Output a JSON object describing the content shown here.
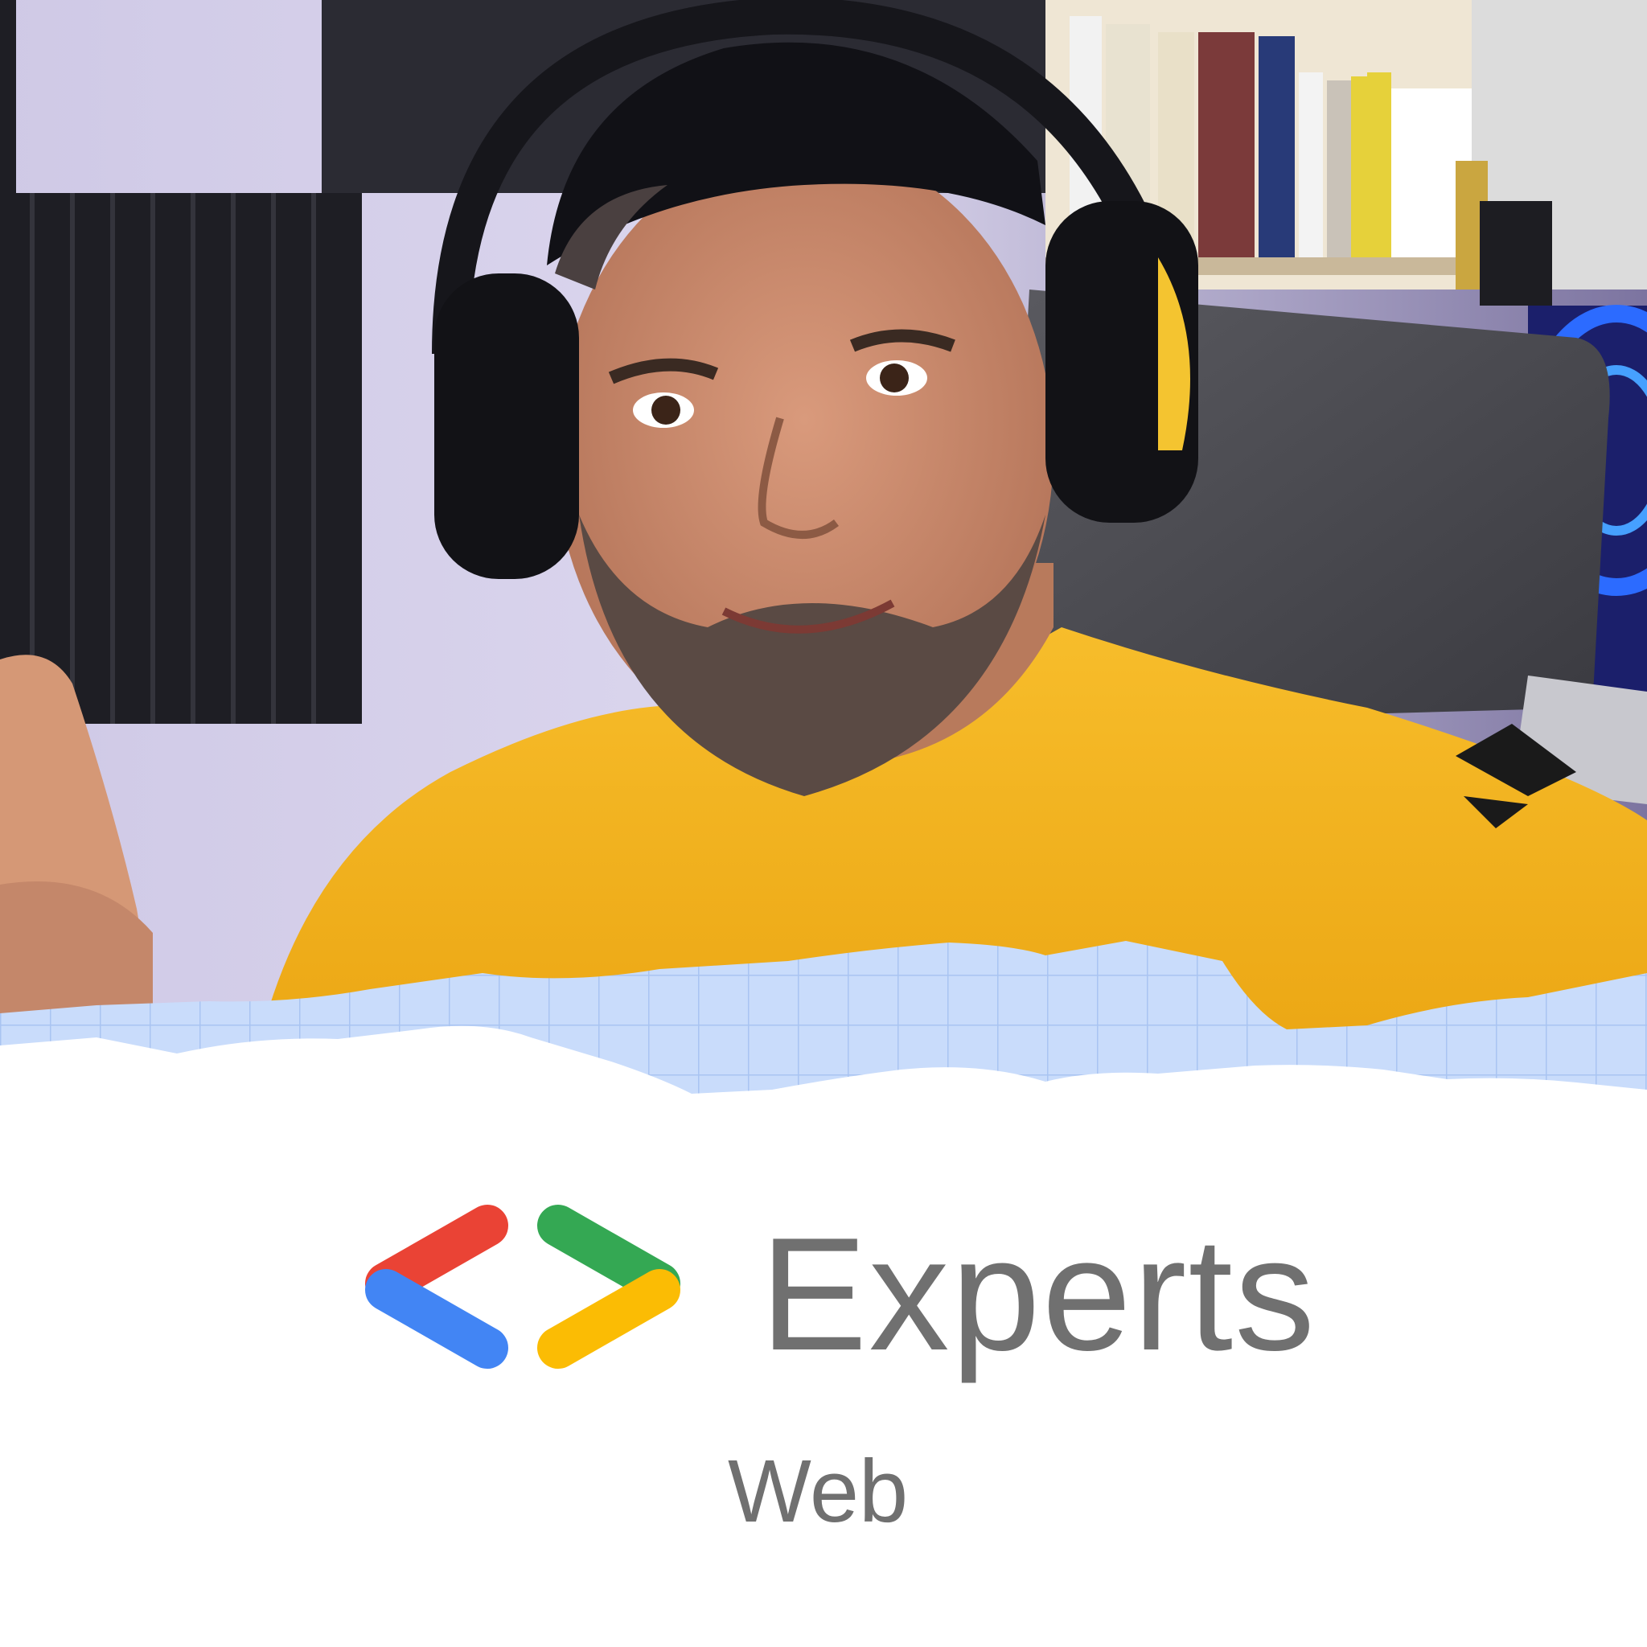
{
  "brand": {
    "wordmark": "Experts",
    "category": "Web",
    "logo_icon": "developers-brackets-logo-icon",
    "logo_colors": {
      "red": "#EA4335",
      "blue": "#4285F4",
      "green": "#34A853",
      "yellow": "#FBBC04"
    },
    "text_color": "#707070"
  },
  "photo": {
    "subject": "person-portrait-photo",
    "shirt_color": "#F5B323",
    "accent_color": "#C9DCFB"
  }
}
